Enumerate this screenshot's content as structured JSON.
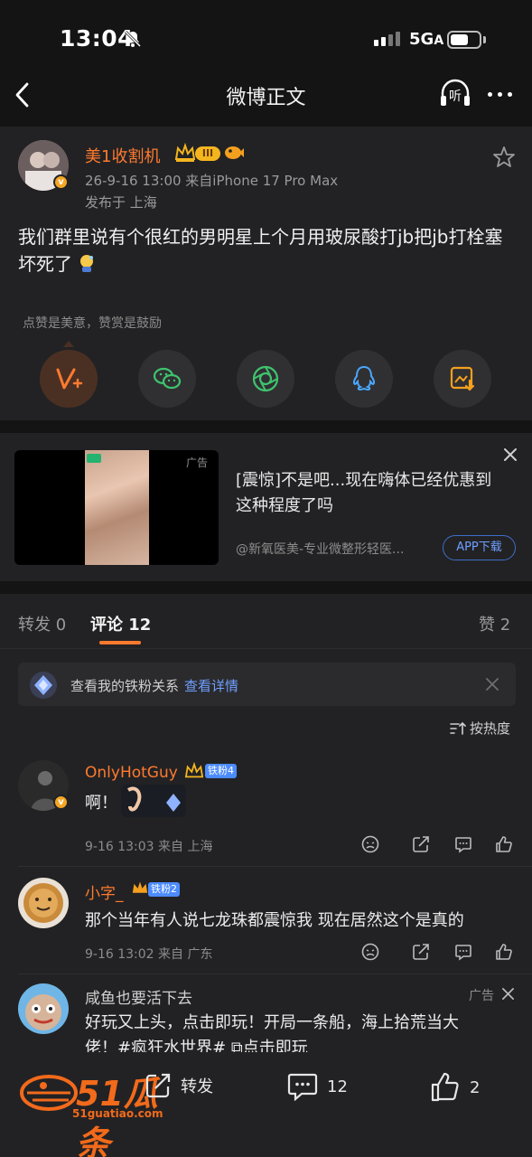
{
  "status_bar": {
    "time": "13:04",
    "network": "5G",
    "network_suffix": "A"
  },
  "nav": {
    "title": "微博正文",
    "listen_label": "听"
  },
  "post": {
    "author": "美1收割机",
    "level": "III",
    "meta": "26-9-16 13:00  来自iPhone 17 Pro Max",
    "location": "发布于 上海",
    "text": "我们群里说有个很红的男明星上个月用玻尿酸打jb把jb打栓塞坏死了",
    "reward_hint": "点赞是美意，赞赏是鼓励",
    "share_targets": [
      "reward-icon",
      "wechat-icon",
      "moments-icon",
      "qq-icon",
      "save-image-icon"
    ]
  },
  "ad": {
    "label": "广告",
    "title": "[震惊]不是吧...现在嗨体已经优惠到这种程度了吗",
    "source": "@新氧医美-专业微整形轻医...",
    "button": "APP下载"
  },
  "tabs": {
    "repost": "转发 0",
    "comments": "评论 12",
    "likes": "赞 2"
  },
  "fan_banner": {
    "text": "查看我的铁粉关系",
    "link": "查看详情"
  },
  "sort": {
    "label": "按热度"
  },
  "comments": [
    {
      "name": "OnlyHotGuy",
      "fan_tag": "铁粉4",
      "text": "啊！",
      "meta": "9-16 13:03 来自 上海"
    },
    {
      "name": "小字_",
      "fan_tag": "铁粉2",
      "text": "那个当年有人说七龙珠都震惊我  现在居然这个是真的",
      "meta": "9-16 13:02 来自 广东"
    }
  ],
  "ad_comment": {
    "name": "咸鱼也要活下去",
    "label": "广告",
    "line1": "好玩又上头，点击即玩！开局一条船，海上拾荒当大",
    "line2": "佬！#疯狂水世界# ⧉点击即玩"
  },
  "bottom_bar": {
    "repost": "转发",
    "comments": "12",
    "likes": "2"
  },
  "watermark": {
    "text": "51瓜条",
    "url": "51guatiao.com"
  },
  "colors": {
    "accent": "#ff7a2e",
    "link": "#6fa0ff",
    "background": "#141414",
    "card": "#222224"
  }
}
